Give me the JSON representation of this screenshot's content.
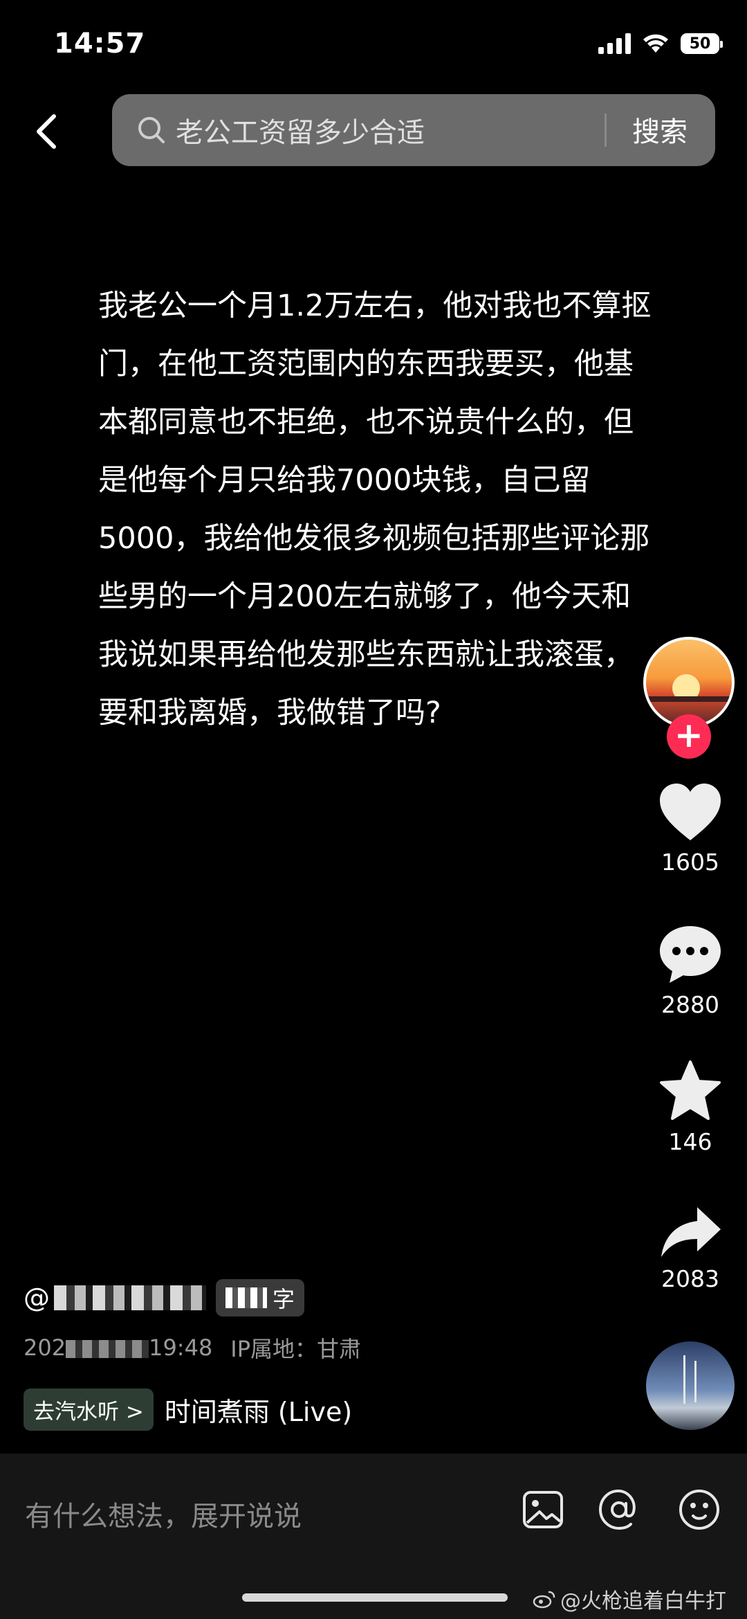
{
  "status_bar": {
    "time": "14:57",
    "battery": "50"
  },
  "search": {
    "query": "老公工资留多少合适",
    "button": "搜索"
  },
  "post": {
    "text": "我老公一个月1.2万左右，他对我也不算抠门，在他工资范围内的东西我要买，他基本都同意也不拒绝，也不说贵什么的，但是他每个月只给我7000块钱，自己留5000，我给他发很多视频包括那些评论那些男的一个月200左右就够了，他今天和我说如果再给他发那些东西就让我滚蛋，要和我离婚，我做错了吗?"
  },
  "actions": {
    "follow": "+",
    "likes": "1605",
    "comments": "2880",
    "favorites": "146",
    "shares": "2083"
  },
  "author": {
    "prefix": "@",
    "tag_suffix": "字",
    "date_prefix": "202",
    "time": "19:48",
    "ip": "IP属地：甘肃"
  },
  "music": {
    "chip": "去汽水听",
    "chip_arrow": ">",
    "title": "时间煮雨 (Live)"
  },
  "comment_bar": {
    "placeholder": "有什么想法，展开说说"
  },
  "watermark": "@火枪追着白牛打"
}
